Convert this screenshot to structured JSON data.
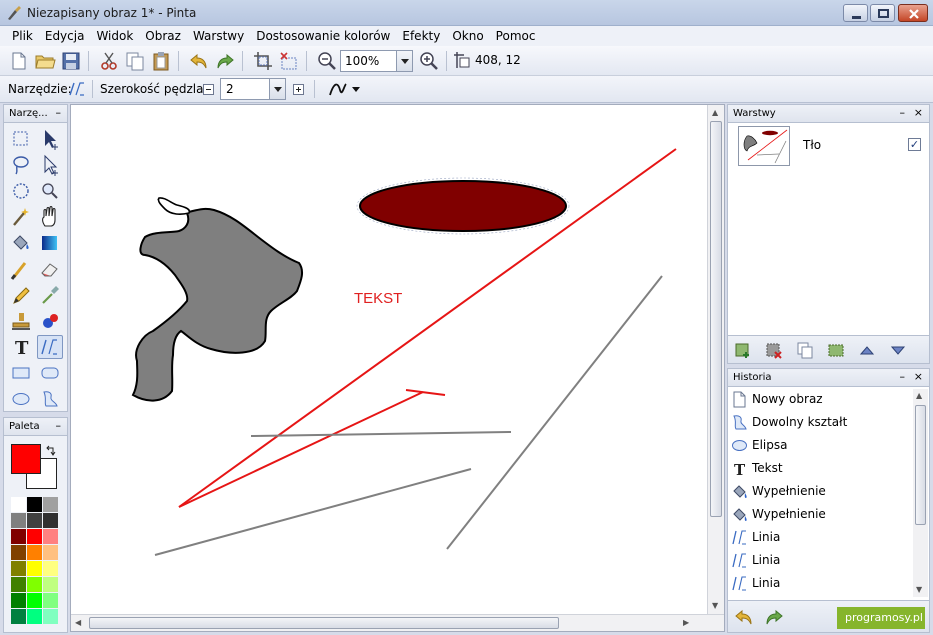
{
  "window": {
    "title": "Niezapisany obraz 1* - Pinta"
  },
  "menu": [
    "Plik",
    "Edycja",
    "Widok",
    "Obraz",
    "Warstwy",
    "Dostosowanie kolorów",
    "Efekty",
    "Okno",
    "Pomoc"
  ],
  "toolbar": {
    "zoom_value": "100%",
    "cursor_position": "408, 12"
  },
  "tool_options": {
    "tool_label": "Narzędzie:",
    "brush_width_label": "Szerokość pędzla:",
    "brush_width_value": "2"
  },
  "tools_panel": {
    "title": "Narzę..."
  },
  "palette_panel": {
    "title": "Paleta",
    "primary_color": "#ff0000",
    "secondary_color": "#ffffff"
  },
  "canvas": {
    "text": "TEKST"
  },
  "layers_panel": {
    "title": "Warstwy",
    "layers": [
      {
        "name": "Tło",
        "visible": true
      }
    ]
  },
  "history_panel": {
    "title": "Historia",
    "items": [
      {
        "label": "Nowy obraz",
        "icon": "document-icon"
      },
      {
        "label": "Dowolny kształt",
        "icon": "freeform-shape-icon"
      },
      {
        "label": "Elipsa",
        "icon": "ellipse-icon"
      },
      {
        "label": "Tekst",
        "icon": "text-icon"
      },
      {
        "label": "Wypełnienie",
        "icon": "paint-bucket-icon"
      },
      {
        "label": "Wypełnienie",
        "icon": "paint-bucket-icon"
      },
      {
        "label": "Linia",
        "icon": "line-icon"
      },
      {
        "label": "Linia",
        "icon": "line-icon"
      },
      {
        "label": "Linia",
        "icon": "line-icon"
      }
    ]
  },
  "brand": {
    "text": "programosy.pl"
  }
}
